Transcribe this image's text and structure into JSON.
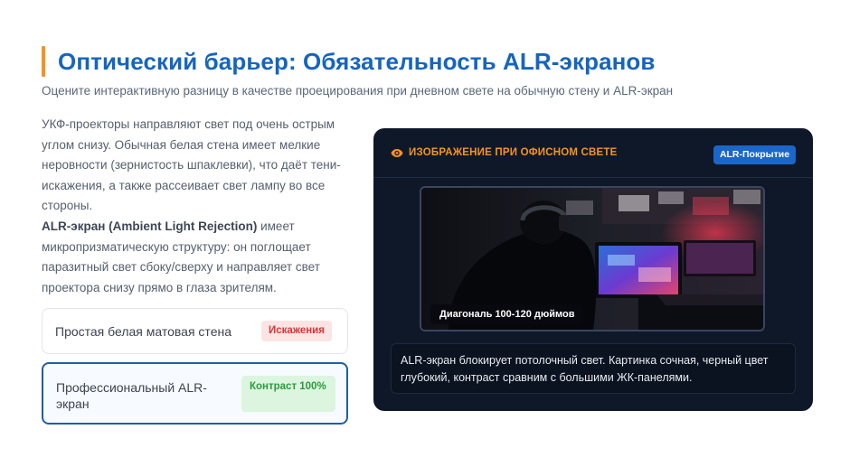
{
  "header": {
    "title": "Оптический барьер: Обязательность ALR-экранов",
    "subtitle": "Оцените интерактивную разницу в качестве проецирования при дневном свете на обычную стену и ALR-экран"
  },
  "explanation": {
    "paragraph_1": "УКФ-проекторы направляют свет под очень острым углом снизу. Обычная белая стена имеет мелкие неровности (зернистость шпаклевки), что даёт тени-искажения, а также рассеивает свет лампу во все стороны.",
    "bold_term": "ALR-экран (Ambient Light Rejection)",
    "paragraph_2_rest": " имеет микропризматическую структуру: он поглощает паразитный свет сбоку/сверху и направляет свет проектора снизу прямо в глаза зрителям."
  },
  "options": [
    {
      "label": "Простая белая матовая стена",
      "badge": "Искажения",
      "selected": false
    },
    {
      "label": "Профессиональный ALR-экран",
      "badge": "Контраст 100%",
      "selected": true
    }
  ],
  "preview": {
    "icon": "eye-icon",
    "heading": "ИЗОБРАЖЕНИЕ ПРИ ОФИСНОМ СВЕТЕ",
    "badge": "ALR-Покрытие",
    "image_badge": "Диагональ 100-120 дюймов",
    "caption": "ALR-экран блокирует потолочный свет. Картинка сочная, черный цвет глубокий, контраст сравним с большими ЖК-панелями."
  },
  "colors": {
    "accent": "#f7931e",
    "brand": "#1565c0",
    "panel_background": "#0f1829",
    "selected_border": "#1f5da8",
    "badge_blue": "#1a67c9"
  }
}
